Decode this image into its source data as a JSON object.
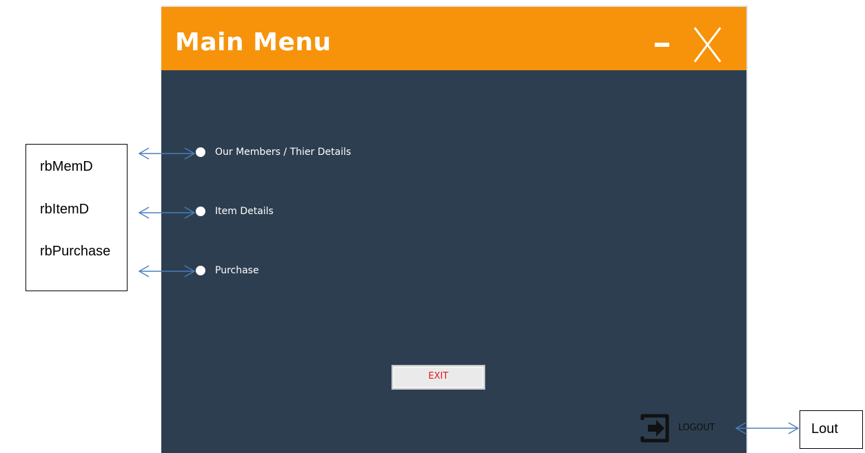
{
  "window": {
    "title": "Main Menu",
    "title_bar_color": "#f7930a",
    "body_color": "#2d3e50"
  },
  "menu": {
    "options": [
      {
        "label": "Our Members / Thier Details"
      },
      {
        "label": "Item Details"
      },
      {
        "label": "Purchase"
      }
    ]
  },
  "buttons": {
    "exit_label": "EXIT",
    "logout_label": "LOGOUT"
  },
  "icons": {
    "minimize": "minimize-icon",
    "close": "close-icon",
    "logout": "logout-icon"
  },
  "annotations": {
    "radio_names": [
      "rbMemD",
      "rbItemD",
      "rbPurchase"
    ],
    "logout_name": "Lout",
    "arrow_color": "#4a7ebb"
  }
}
